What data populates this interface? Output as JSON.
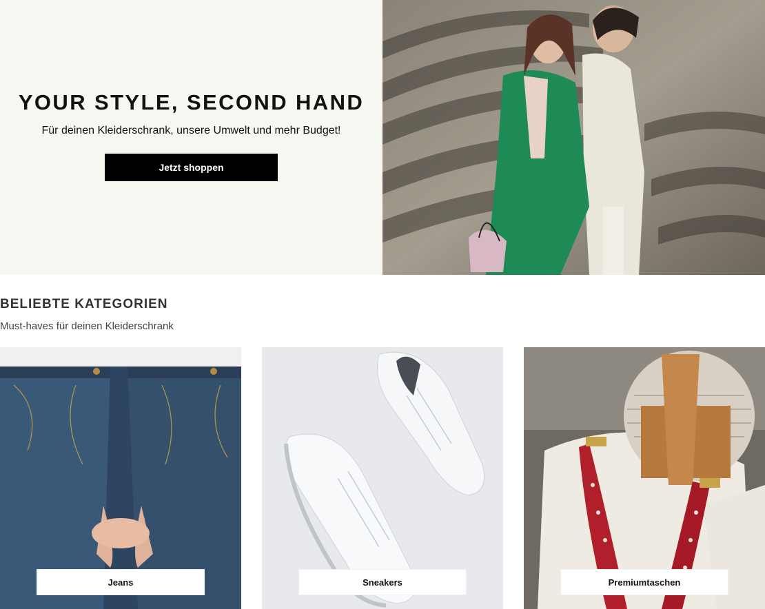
{
  "hero": {
    "title": "YOUR STYLE, SECOND HAND",
    "subtitle": "Für deinen Kleiderschrank, unsere Umwelt und mehr Budget!",
    "cta_label": "Jetzt shoppen",
    "image": "fashion-couple-photo",
    "background_color": "#f7f7f2",
    "cta_color": "#000000"
  },
  "categories": {
    "title": "BELIEBTE KATEGORIEN",
    "subtitle": "Must-haves für deinen Kleiderschrank",
    "items": [
      {
        "label": "Jeans",
        "image": "jeans-photo"
      },
      {
        "label": "Sneakers",
        "image": "sneakers-photo"
      },
      {
        "label": "Premiumtaschen",
        "image": "bag-photo"
      }
    ]
  }
}
